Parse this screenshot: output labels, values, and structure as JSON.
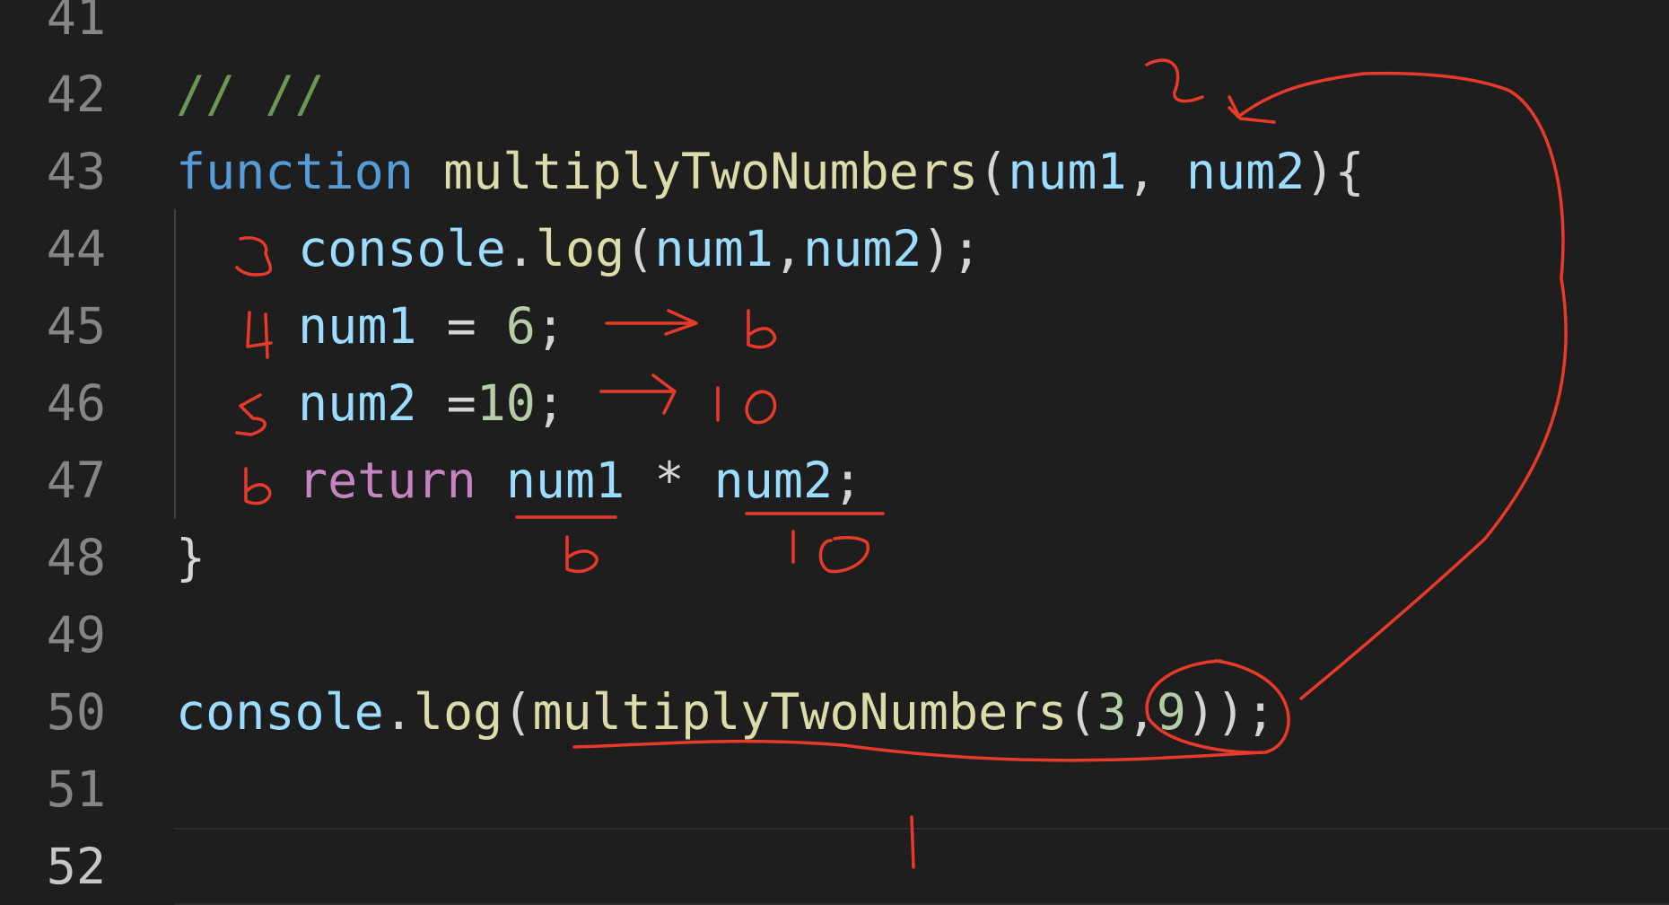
{
  "editor": {
    "language": "javascript",
    "lines": [
      {
        "number": "41",
        "text": ""
      },
      {
        "number": "42",
        "text": "// //"
      },
      {
        "number": "43",
        "parts": [
          "function",
          "multiplyTwoNumbers",
          "(",
          "num1",
          ", ",
          "num2",
          "){"
        ]
      },
      {
        "number": "44",
        "parts": [
          "console",
          ".",
          "log",
          "(",
          "num1",
          ",",
          "num2",
          ");"
        ]
      },
      {
        "number": "45",
        "parts": [
          "num1",
          " = ",
          "6",
          ";"
        ]
      },
      {
        "number": "46",
        "parts": [
          "num2",
          " =",
          "10",
          ";"
        ]
      },
      {
        "number": "47",
        "parts": [
          "return",
          " ",
          "num1",
          " * ",
          "num2",
          ";"
        ]
      },
      {
        "number": "48",
        "parts": [
          "}"
        ]
      },
      {
        "number": "49",
        "text": ""
      },
      {
        "number": "50",
        "parts": [
          "console",
          ".",
          "log",
          "(",
          "multiplyTwoNumbers",
          "(",
          "3",
          ",",
          "9",
          "));"
        ]
      },
      {
        "number": "51",
        "text": ""
      },
      {
        "number": "52",
        "text": ""
      }
    ],
    "active_line": "52"
  },
  "annotations": {
    "color": "#e83a2a",
    "step_numbers": [
      "2",
      "3",
      "4",
      "5",
      "6"
    ],
    "values": [
      "6",
      "10",
      "6",
      "10",
      "1"
    ]
  },
  "theme": {
    "background": "#1e1e1e",
    "keyword": "#569cd6",
    "function": "#dcdcaa",
    "variable": "#9cdcfe",
    "number": "#b5cea8",
    "comment": "#6a9955",
    "control": "#c586c0",
    "line_number": "#858585"
  }
}
